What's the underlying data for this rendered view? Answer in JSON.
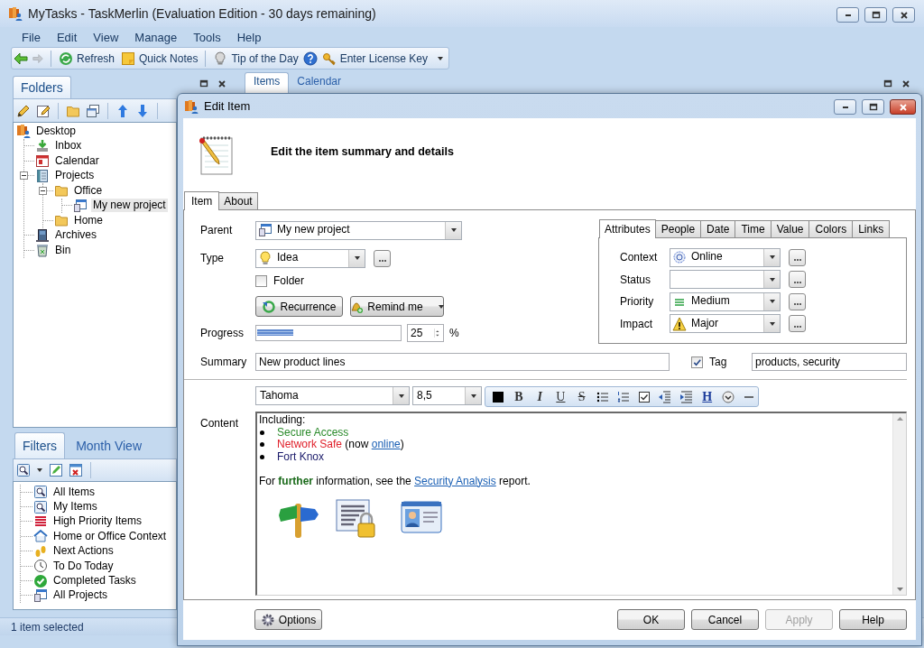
{
  "window": {
    "title": "MyTasks - TaskMerlin (Evaluation Edition - 30 days remaining)"
  },
  "menu": [
    {
      "label": "File"
    },
    {
      "label": "Edit"
    },
    {
      "label": "View"
    },
    {
      "label": "Manage"
    },
    {
      "label": "Tools"
    },
    {
      "label": "Help"
    }
  ],
  "toolbar": [
    {
      "kind": "back",
      "disabled": false
    },
    {
      "kind": "forward",
      "disabled": true
    },
    {
      "kind": "refresh",
      "label": "Refresh",
      "disabled": false
    },
    {
      "kind": "notes",
      "label": "Quick Notes",
      "disabled": false
    },
    {
      "kind": "tip",
      "label": "Tip of the Day",
      "disabled": false
    },
    {
      "kind": "help",
      "disabled": false
    },
    {
      "kind": "key",
      "label": "Enter License Key",
      "disabled": false
    },
    {
      "kind": "more",
      "disabled": false
    }
  ],
  "folders_pane": {
    "tabs": [
      {
        "label": "Folders",
        "selected": true
      }
    ],
    "tree": [
      {
        "label": "Desktop",
        "kind": "desktop",
        "selected": false,
        "children": [
          {
            "label": "Inbox",
            "kind": "inbox",
            "selected": false
          },
          {
            "label": "Calendar",
            "kind": "calendar",
            "selected": false
          },
          {
            "label": "Projects",
            "kind": "projects",
            "selected": false,
            "expanded": true,
            "children": [
              {
                "label": "Office",
                "kind": "folder",
                "selected": false,
                "expanded": true,
                "children": [
                  {
                    "label": "My new project",
                    "kind": "project",
                    "selected": true
                  }
                ]
              },
              {
                "label": "Home",
                "kind": "folder",
                "selected": false
              }
            ]
          },
          {
            "label": "Archives",
            "kind": "archives",
            "selected": false
          },
          {
            "label": "Bin",
            "kind": "bin",
            "selected": false
          }
        ]
      }
    ]
  },
  "document_tabs": [
    {
      "label": "Items",
      "selected": true
    },
    {
      "label": "Calendar",
      "selected": false
    }
  ],
  "filters_pane": {
    "tabs": [
      {
        "label": "Filters",
        "selected": true
      },
      {
        "label": "Month View",
        "selected": false
      }
    ],
    "items": [
      {
        "label": "All Items",
        "kind": "search"
      },
      {
        "label": "My Items",
        "kind": "search"
      },
      {
        "label": "High Priority Items",
        "kind": "priority"
      },
      {
        "label": "Home or Office Context",
        "kind": "context"
      },
      {
        "label": "Next Actions",
        "kind": "actions"
      },
      {
        "label": "To Do Today",
        "kind": "today"
      },
      {
        "label": "Completed Tasks",
        "kind": "completed"
      },
      {
        "label": "All Projects",
        "kind": "projects"
      }
    ]
  },
  "status_bar": {
    "text": "1 item selected"
  },
  "dialog": {
    "title": "Edit Item",
    "heading": "Edit the item summary and details",
    "tabs": [
      {
        "label": "Item",
        "selected": true
      },
      {
        "label": "About",
        "selected": false
      }
    ],
    "parent": {
      "label": "Parent",
      "value": "My new project"
    },
    "type": {
      "label": "Type",
      "value": "Idea"
    },
    "folder": {
      "label": "Folder",
      "checked": false
    },
    "actions": [
      {
        "kind": "recurrence",
        "label": "Recurrence"
      },
      {
        "kind": "remind",
        "label": "Remind me"
      }
    ],
    "progress": {
      "label": "Progress",
      "level": 0.25,
      "value": "25",
      "unit": "%"
    },
    "summary": {
      "label": "Summary",
      "value": "New product lines"
    },
    "tag": {
      "label": "Tag",
      "checked": true,
      "value": "products, security"
    },
    "attribute_tabs": [
      {
        "label": "Attributes",
        "selected": true
      },
      {
        "label": "People",
        "selected": false
      },
      {
        "label": "Date",
        "selected": false
      },
      {
        "label": "Time",
        "selected": false
      },
      {
        "label": "Value",
        "selected": false
      },
      {
        "label": "Colors",
        "selected": false
      },
      {
        "label": "Links",
        "selected": false
      }
    ],
    "attributes": [
      {
        "kind": "context",
        "label": "Context",
        "value": "Online"
      },
      {
        "kind": "status",
        "label": "Status"
      },
      {
        "kind": "priority",
        "label": "Priority",
        "value": "Medium"
      },
      {
        "kind": "impact",
        "label": "Impact",
        "value": "Major"
      }
    ],
    "content": {
      "label": "Content",
      "font": "Tahoma",
      "size": "8,5",
      "format_buttons": [
        {
          "kind": "color"
        },
        {
          "kind": "bold",
          "label": "B"
        },
        {
          "kind": "italic",
          "label": "I"
        },
        {
          "kind": "underline",
          "label": "U"
        },
        {
          "kind": "strike",
          "label": "S"
        },
        {
          "kind": "bullets"
        },
        {
          "kind": "numbering"
        },
        {
          "kind": "checklist"
        },
        {
          "kind": "outdent"
        },
        {
          "kind": "indent"
        },
        {
          "kind": "heading",
          "label": "H"
        },
        {
          "kind": "more"
        },
        {
          "kind": "line"
        }
      ],
      "lines": [
        {
          "kind": "text",
          "parts": [
            {
              "text": "Including:"
            }
          ]
        },
        {
          "kind": "bullet",
          "parts": [
            {
              "text": "Secure Access",
              "color": "#2a8a2a"
            }
          ]
        },
        {
          "kind": "bullet",
          "parts": [
            {
              "text": "Network Safe",
              "color": "#e0202a"
            },
            {
              "text": " (now "
            },
            {
              "text": "online",
              "kind": "link"
            },
            {
              "text": ")"
            }
          ]
        },
        {
          "kind": "bullet",
          "parts": [
            {
              "text": "Fort Knox",
              "color": "#1a1a6a"
            }
          ]
        },
        {
          "kind": "paragraph",
          "parts": [
            {
              "text": "For "
            },
            {
              "text": "further",
              "kind": "strong",
              "color": "#1a6a1a"
            },
            {
              "text": " information, see the "
            },
            {
              "text": "Security Analysis",
              "kind": "link"
            },
            {
              "text": " report."
            }
          ]
        }
      ],
      "pictures": [
        {
          "kind": "signpost"
        },
        {
          "kind": "locked_document"
        },
        {
          "kind": "contact_card"
        }
      ]
    },
    "buttons": [
      {
        "kind": "options",
        "label": "Options",
        "disabled": false
      },
      {
        "kind": "ok",
        "label": "OK",
        "disabled": false
      },
      {
        "kind": "cancel",
        "label": "Cancel",
        "disabled": false
      },
      {
        "kind": "apply",
        "label": "Apply",
        "disabled": true
      },
      {
        "kind": "help",
        "label": "Help",
        "disabled": false
      }
    ]
  }
}
